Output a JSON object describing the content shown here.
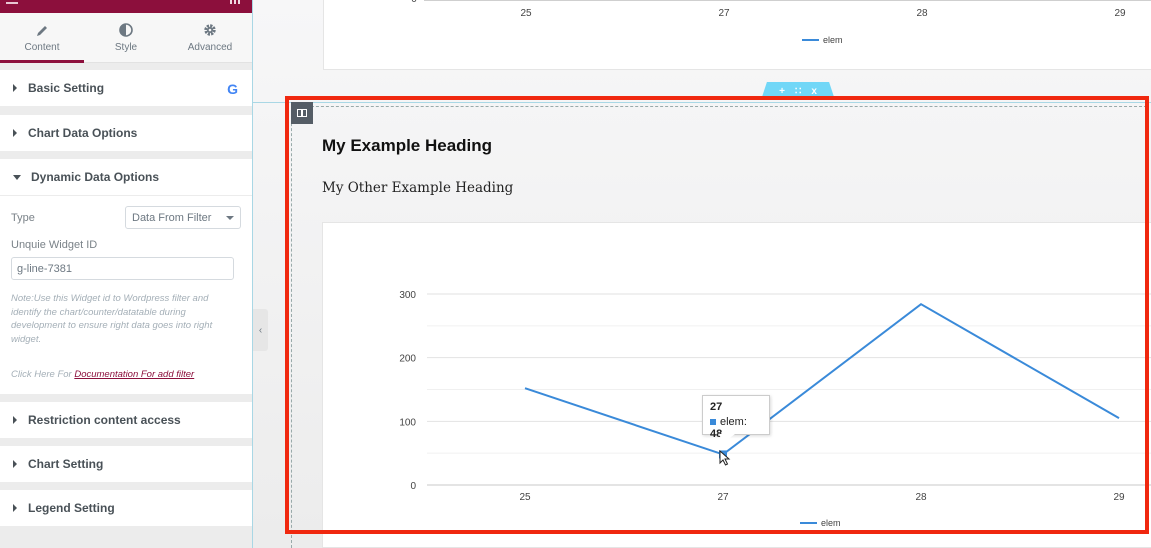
{
  "panel": {
    "tabs": [
      {
        "label": "Content",
        "icon": "pencil-icon",
        "active": true
      },
      {
        "label": "Style",
        "icon": "contrast-icon",
        "active": false
      },
      {
        "label": "Advanced",
        "icon": "gear-icon",
        "active": false
      }
    ],
    "sections": {
      "basic": "Basic Setting",
      "chart_data": "Chart Data Options",
      "dynamic": "Dynamic Data Options",
      "restriction": "Restriction content access",
      "chart_setting": "Chart Setting",
      "legend_setting": "Legend Setting"
    },
    "dynamic": {
      "type_label": "Type",
      "type_value": "Data From Filter",
      "widget_id_label": "Unquie Widget ID",
      "widget_id_value": "g-line-7381",
      "note": "Note:Use this Widget id to Wordpress filter and identify the chart/counter/datatable during development to ensure right data goes into right widget.",
      "click_prefix": "Click Here For ",
      "doc_link": "Documentation For add filter"
    },
    "brand_color": "#8c0f3c"
  },
  "canvas": {
    "top_chart": {
      "y_tick_visible": "0",
      "x_ticks": [
        "25",
        "27",
        "28",
        "29"
      ],
      "legend": "elem"
    },
    "editor_handle": {
      "add": "+",
      "move": "∷",
      "close": "x"
    },
    "heading": "My Example Heading",
    "subheading": "My Other Example Heading",
    "highlight_color": "#f0280f"
  },
  "chart_data": {
    "type": "line",
    "title": "",
    "xlabel": "",
    "ylabel": "",
    "categories": [
      "25",
      "27",
      "28",
      "29"
    ],
    "series": [
      {
        "name": "elem",
        "color": "#3a8ad9",
        "values": [
          152,
          48,
          284,
          105
        ]
      }
    ],
    "ylim": [
      0,
      300
    ],
    "y_ticks": [
      0,
      100,
      200,
      300
    ],
    "grid": true,
    "legend_position": "bottom",
    "tooltip": {
      "category": "27",
      "series": "elem",
      "value": "48"
    }
  }
}
